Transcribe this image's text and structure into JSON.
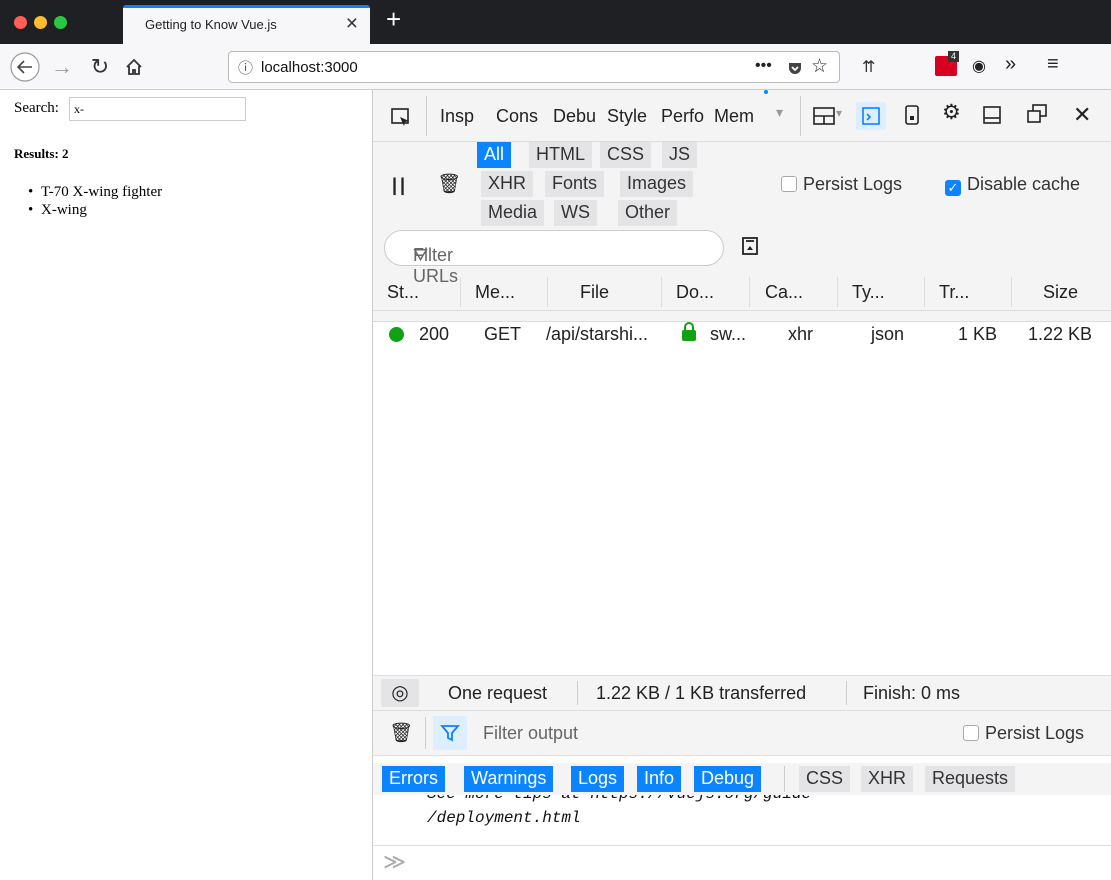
{
  "browser": {
    "tab_title": "Getting to Know Vue.js",
    "url": "localhost:3000",
    "colors": {
      "accent": "#0a84ff",
      "titlebar": "#1f2024"
    }
  },
  "page": {
    "search_label": "Search:",
    "search_value": "x-",
    "results_label": "Results: 2",
    "results": [
      "T-70 X-wing fighter",
      "X-wing"
    ]
  },
  "devtools": {
    "tabs": [
      "Insp",
      "Cons",
      "Debu",
      "Style",
      "Perfo",
      "Mem"
    ],
    "network": {
      "type_filters": [
        {
          "label": "All",
          "active": true
        },
        {
          "label": "HTML",
          "active": false
        },
        {
          "label": "CSS",
          "active": false
        },
        {
          "label": "JS",
          "active": false
        },
        {
          "label": "XHR",
          "active": false
        },
        {
          "label": "Fonts",
          "active": false
        },
        {
          "label": "Images",
          "active": false
        },
        {
          "label": "Media",
          "active": false
        },
        {
          "label": "WS",
          "active": false
        },
        {
          "label": "Other",
          "active": false
        }
      ],
      "persist_logs": "Persist Logs",
      "disable_cache": "Disable cache",
      "filter_placeholder": "Filter URLs",
      "columns": [
        "St...",
        "Me...",
        "File",
        "Do...",
        "Ca...",
        "Ty...",
        "Tr...",
        "Size"
      ],
      "request": {
        "status": "200",
        "method": "GET",
        "file": "/api/starshi...",
        "domain": "sw...",
        "cause": "xhr",
        "type": "json",
        "transferred": "1 KB",
        "size": "1.22 KB",
        "status_color": "#12a112"
      },
      "summary": {
        "requests": "One request",
        "transferred": "1.22 KB / 1 KB transferred",
        "finish": "Finish: 0 ms"
      }
    },
    "console": {
      "filter_placeholder": "Filter output",
      "persist_logs": "Persist Logs",
      "level_filters": [
        "Errors",
        "Warnings",
        "Logs",
        "Info",
        "Debug"
      ],
      "other_filters": [
        "CSS",
        "XHR",
        "Requests"
      ],
      "output_line1": "See more tips at https://vuejs.org/guide",
      "output_line2": "/deployment.html"
    }
  }
}
